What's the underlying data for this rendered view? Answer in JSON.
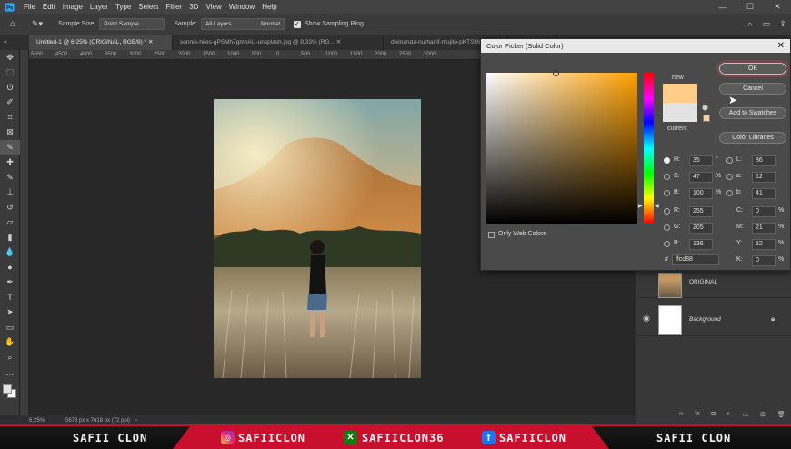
{
  "menu": {
    "items": [
      "File",
      "Edit",
      "Image",
      "Layer",
      "Type",
      "Select",
      "Filter",
      "3D",
      "View",
      "Window",
      "Help"
    ]
  },
  "options": {
    "sample_size_label": "Sample Size:",
    "sample_size_value": "Point Sample",
    "sample_label": "Sample:",
    "sample_value": "All Layers",
    "sample_extra": "Normal",
    "sampling_ring_label": "Show Sampling Ring"
  },
  "tabs": [
    {
      "label": "Untitled-1 @ 6,25% (ORIGINAL, RGB/8) *"
    },
    {
      "label": "sonnie-hiles-gPSMh7gmhAU-unsplash.jpg @ 8,33% (RG..."
    },
    {
      "label": "dwinanda-nurhanif-mujito-pKTSMg..."
    }
  ],
  "ruler": {
    "ticks": [
      "5000",
      "4500",
      "4000",
      "3500",
      "3000",
      "2500",
      "2000",
      "1500",
      "1000",
      "500",
      "0",
      "500",
      "1000",
      "1500",
      "2000",
      "2500",
      "3000"
    ]
  },
  "status": {
    "zoom": "6,25%",
    "doc_size": "5673 px x 7618 px (72 ppi)"
  },
  "dialog": {
    "title": "Color Picker (Solid Color)",
    "ok_label": "OK",
    "cancel_label": "Cancel",
    "add_swatches_label": "Add to Swatches",
    "color_libraries_label": "Color Libraries",
    "new_label": "new",
    "current_label": "current",
    "web_colors_label": "Only Web Colors",
    "hex_label": "#",
    "hex_value": "ffcd88",
    "new_color": "#ffcd88",
    "current_color": "#e3e3e3",
    "fields_left": [
      {
        "label": "H:",
        "value": "35",
        "unit": "°"
      },
      {
        "label": "S:",
        "value": "47",
        "unit": "%"
      },
      {
        "label": "B:",
        "value": "100",
        "unit": "%"
      },
      {
        "label": "R:",
        "value": "255",
        "unit": ""
      },
      {
        "label": "G:",
        "value": "205",
        "unit": ""
      },
      {
        "label": "B:",
        "value": "136",
        "unit": ""
      }
    ],
    "fields_right": [
      {
        "label": "L:",
        "value": "86",
        "unit": ""
      },
      {
        "label": "a:",
        "value": "12",
        "unit": ""
      },
      {
        "label": "b:",
        "value": "41",
        "unit": ""
      },
      {
        "label": "C:",
        "value": "0",
        "unit": "%"
      },
      {
        "label": "M:",
        "value": "21",
        "unit": "%"
      },
      {
        "label": "Y:",
        "value": "52",
        "unit": "%"
      },
      {
        "label": "K:",
        "value": "0",
        "unit": "%"
      }
    ]
  },
  "layers": [
    {
      "name": "ORIGINAL"
    },
    {
      "name": "Background"
    }
  ],
  "footer": {
    "left_name": "SAFII CLON",
    "instagram": "SAFIICLON",
    "xbox": "SAFIICLON36",
    "facebook": "SAFIICLON",
    "right_name": "SAFII CLON"
  },
  "colors": {
    "accent": "#c8102e",
    "panel": "#383838"
  }
}
